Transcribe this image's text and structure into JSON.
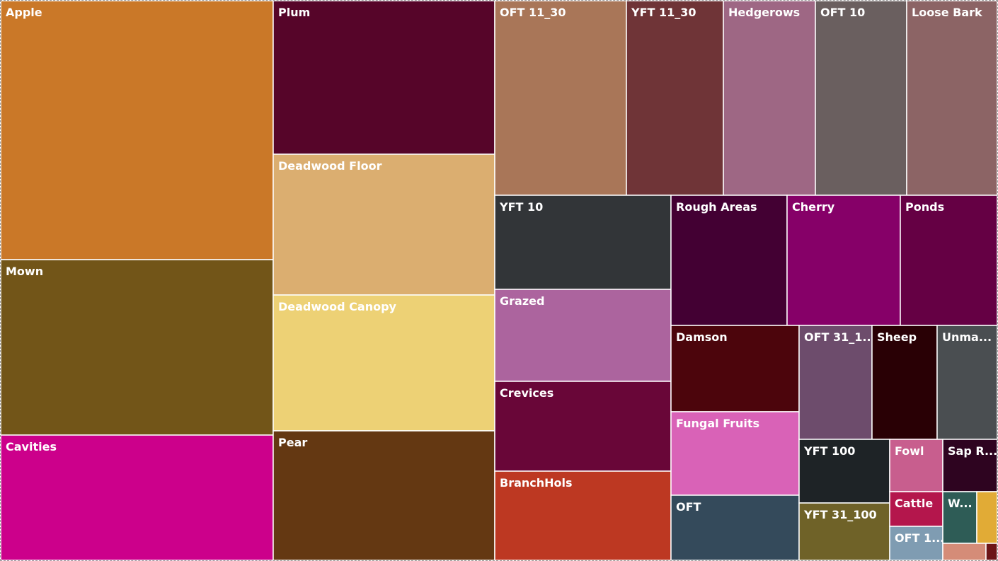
{
  "chart_data": {
    "type": "treemap",
    "title": "",
    "nodes": [
      {
        "name": "Apple",
        "value": 140160,
        "color": "#CA7828"
      },
      {
        "name": "Mown",
        "value": 95424,
        "color": "#725518"
      },
      {
        "name": "Cavities",
        "value": 68425,
        "color": "#CC008B"
      },
      {
        "name": "Plum",
        "value": 67704,
        "color": "#560529"
      },
      {
        "name": "Deadwood Floor",
        "value": 61344,
        "color": "#DBAE70"
      },
      {
        "name": "Deadwood Canopy",
        "value": 59904,
        "color": "#EDD175"
      },
      {
        "name": "Pear",
        "value": 56472,
        "color": "#643812"
      },
      {
        "name": "OFT 11_30",
        "value": 51150,
        "color": "#A97658"
      },
      {
        "name": "YFT 11_30",
        "value": 36990,
        "color": "#6F3437"
      },
      {
        "name": "Hedgerows",
        "value": 35360,
        "color": "#9E6784"
      },
      {
        "name": "OFT 10",
        "value": 35370,
        "color": "#6A5F5F"
      },
      {
        "name": "Loose Bark",
        "value": 35370,
        "color": "#8C6465"
      },
      {
        "name": "YFT 10",
        "value": 33000,
        "color": "#323538"
      },
      {
        "name": "Grazed",
        "value": 32000,
        "color": "#AC649E"
      },
      {
        "name": "Crevices",
        "value": 31500,
        "color": "#690638"
      },
      {
        "name": "BranchHols",
        "value": 31000,
        "color": "#BD3822"
      },
      {
        "name": "Rough Areas",
        "value": 30100,
        "color": "#430033"
      },
      {
        "name": "Cherry",
        "value": 29000,
        "color": "#860068"
      },
      {
        "name": "Ponds",
        "value": 25900,
        "color": "#650044"
      },
      {
        "name": "Damson",
        "value": 22150,
        "color": "#4C050C"
      },
      {
        "name": "Fungal Fruits",
        "value": 21200,
        "color": "#D962B7"
      },
      {
        "name": "OFT",
        "value": 16200,
        "color": "#344A5B"
      },
      {
        "name": "OFT 31_1...",
        "value": 15600,
        "color": "#6D4C6C"
      },
      {
        "name": "Sheep",
        "value": 14400,
        "color": "#290005"
      },
      {
        "name": "Unma...",
        "value": 13500,
        "color": "#4A4E51"
      },
      {
        "name": "YFT 100",
        "value": 11000,
        "color": "#1E2326"
      },
      {
        "name": "YFT 31_100",
        "value": 10100,
        "color": "#6F6228"
      },
      {
        "name": "Fowl",
        "value": 5400,
        "color": "#C85E8E"
      },
      {
        "name": "Sap R...",
        "value": 5050,
        "color": "#2E0420"
      },
      {
        "name": "Cattle",
        "value": 3500,
        "color": "#B4164C"
      },
      {
        "name": "OFT 1...",
        "value": 3200,
        "color": "#7F9CB2"
      },
      {
        "name": "W...",
        "value": 2800,
        "color": "#2E5C56"
      },
      {
        "name": "",
        "value": 1550,
        "color": "#E1AB36"
      },
      {
        "name": "",
        "value": 1200,
        "color": "#D58C78"
      },
      {
        "name": "",
        "value": 300,
        "color": "#6C1517"
      }
    ]
  }
}
